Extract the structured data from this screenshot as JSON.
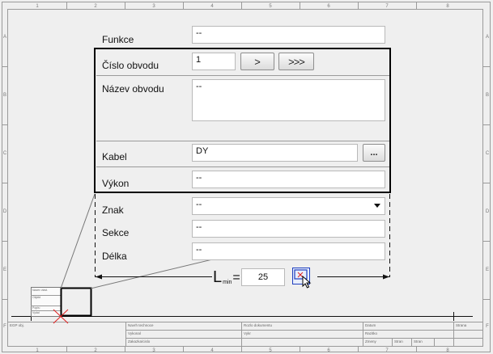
{
  "sheet": {
    "columns_top": [
      "1",
      "2",
      "3",
      "4",
      "5",
      "6",
      "7",
      "8"
    ],
    "columns_bottom": [
      "1",
      "2",
      "3",
      "4",
      "5",
      "6",
      "7",
      "8"
    ],
    "rows": [
      "A",
      "B",
      "C",
      "D",
      "E",
      "F"
    ],
    "title_block": {
      "r1c1": "EGP obj.",
      "r1c2": "Navrh technoce",
      "r1c3": "Rozlo dokumentu",
      "r1c4": "Datum",
      "r1c5": "Strana",
      "r2c2": "Vykonal",
      "r2c3": "Vykr",
      "r2c4": "Razitko",
      "r3c2": "Zakazka/cislo",
      "r3c4": "Zmeny",
      "r3c5": "Stran",
      "r3c6": "Stran"
    },
    "mini_label": "Nazev vlast.\nObjekt\nPopis:\nVydal"
  },
  "form": {
    "funkce": {
      "label": "Funkce",
      "value": "--"
    },
    "cislo_obvodu": {
      "label": "Číslo obvodu",
      "value": "1",
      "next_label": ">",
      "last_label": ">>>"
    },
    "nazev_obvodu": {
      "label": "Název obvodu",
      "value": "--"
    },
    "kabel": {
      "label": "Kabel",
      "value": "DY",
      "browse_label": "..."
    },
    "vykon": {
      "label": "Výkon",
      "value": "--"
    },
    "znak": {
      "label": "Znak",
      "value": "--"
    },
    "sekce": {
      "label": "Sekce",
      "value": "--"
    },
    "delka": {
      "label": "Délka",
      "value": "--"
    }
  },
  "length_min": {
    "symbol": "L",
    "subscript": "min",
    "equals": "=",
    "value": "25"
  },
  "colors": {
    "sheet_line": "#8a8a8a",
    "heavy_frame": "#000000",
    "cross_mark": "#e02020",
    "pick_button": "#1f3fbf"
  }
}
